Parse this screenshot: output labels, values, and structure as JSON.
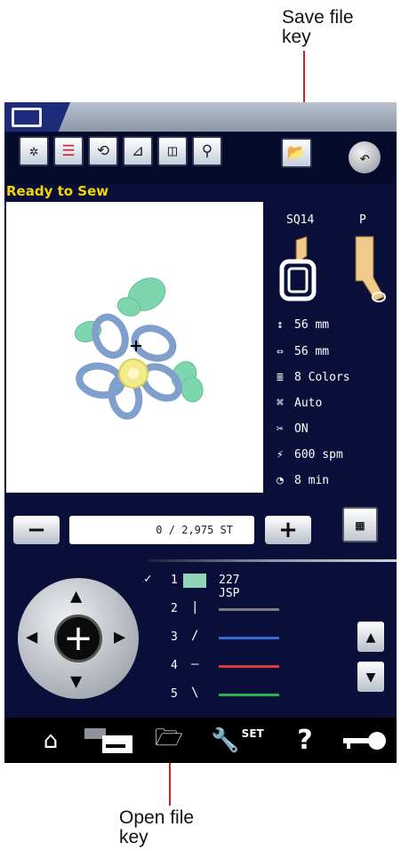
{
  "annotations": {
    "save_line1": "Save file",
    "save_line2": "key",
    "open_line1": "Open file",
    "open_line2": "key"
  },
  "status": "Ready to Sew",
  "hoop": {
    "name": "SQ14",
    "foot": "P"
  },
  "info": {
    "height": "56 mm",
    "width": "56 mm",
    "colors": "8 Colors",
    "mode": "Auto",
    "cutter": "ON",
    "speed": "600 spm",
    "time": "8 min"
  },
  "counter": {
    "text": "0 / 2,975 ST",
    "minus": "−",
    "plus": "+"
  },
  "thread": {
    "selected_number": "1",
    "selected_label": "227  JSP",
    "rows": [
      "2",
      "3",
      "4",
      "5"
    ],
    "colors": {
      "row2": "#7c7c7c",
      "row3": "#2f6fd1",
      "row4": "#d93a3a",
      "row5": "#2ab04a",
      "swatch": "#8fd6b8"
    }
  },
  "bottom": {
    "set_label": "SET",
    "help_label": "?"
  },
  "accent": "#f3d600"
}
